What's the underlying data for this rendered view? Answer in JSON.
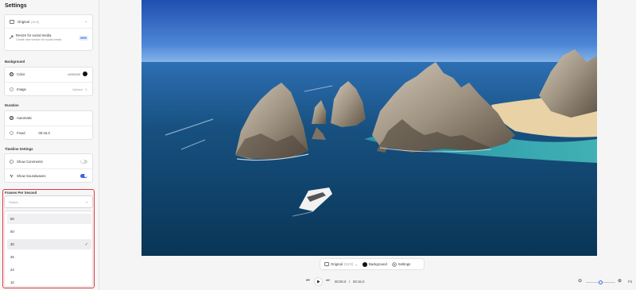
{
  "sidebar": {
    "title": "Settings",
    "aspect": {
      "label": "Original",
      "ratio": "(16:9)"
    },
    "resize": {
      "title": "Resize for social media",
      "subtitle": "Create new version for social media",
      "badge": "NEW"
    },
    "background": {
      "label": "Background",
      "color_label": "Color",
      "color_value": "#000000",
      "image_label": "Image",
      "image_action": "Upload"
    },
    "duration": {
      "label": "Duration",
      "automatic_label": "Automatic",
      "fixed_label": "Fixed",
      "fixed_value": "00:15.0"
    },
    "timeline": {
      "label": "Timeline Settings",
      "comments_label": "Show Comments",
      "comments_on": false,
      "soundwaves_label": "Show Soundwaves",
      "soundwaves_on": true
    },
    "fps": {
      "label": "Frames Per Second",
      "placeholder": "Select...",
      "options": [
        "60",
        "50",
        "30",
        "25",
        "24",
        "10"
      ],
      "selected": "30"
    }
  },
  "toolbar": {
    "aspect_label": "Original",
    "aspect_ratio": "(16:9)",
    "background_label": "Background",
    "settings_label": "Settings"
  },
  "player": {
    "current_time": "00:00.0",
    "separator": "/",
    "total_time": "00:15.0",
    "fit_label": "Fit",
    "zoom_level": 0.45
  },
  "colors": {
    "accent": "#3b64e0",
    "highlight": "#e0383e"
  },
  "icons": [
    "aspect-ratio-icon",
    "resize-icon",
    "chevron-down-icon",
    "check-icon",
    "settings-gear-icon",
    "play-icon",
    "skip-back-icon",
    "skip-forward-icon",
    "zoom-out-icon",
    "zoom-in-icon"
  ]
}
